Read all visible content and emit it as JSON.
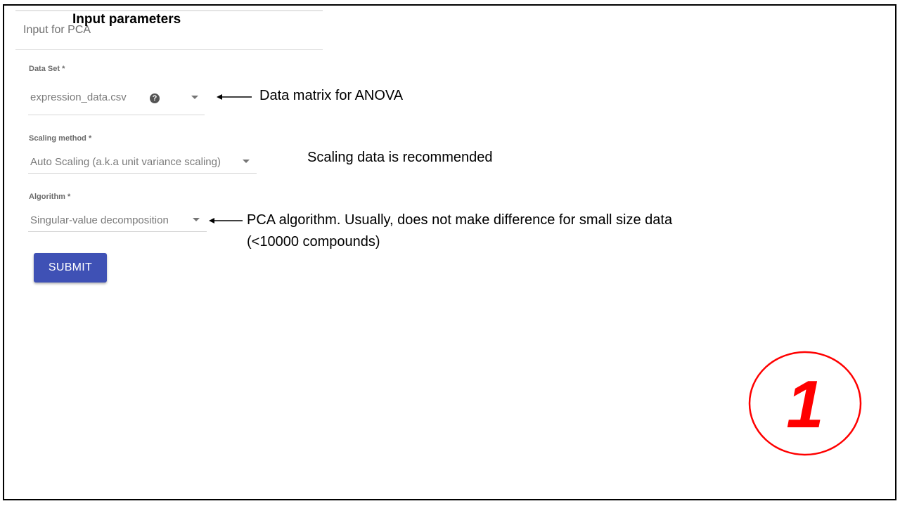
{
  "header": {
    "card_title": "Input for PCA",
    "overlay_title": "Input parameters"
  },
  "fields": {
    "dataset": {
      "label": "Data Set *",
      "value": "expression_data.csv",
      "help_glyph": "?"
    },
    "scaling": {
      "label": "Scaling method *",
      "value": "Auto Scaling (a.k.a unit variance scaling)"
    },
    "algorithm": {
      "label": "Algorithm *",
      "value": "Singular-value decomposition"
    }
  },
  "submit_label": "SUBMIT",
  "annotations": {
    "dataset_note": "Data matrix for ANOVA",
    "scaling_note": "Scaling data is recommended",
    "algorithm_note_line1": "PCA algorithm. Usually, does not make difference for small size data",
    "algorithm_note_line2": "(<10000 compounds)"
  },
  "step_badge": {
    "number": "1",
    "color": "#ff0000"
  },
  "icons": [
    "help-icon",
    "dropdown-caret-icon",
    "arrow-left-icon"
  ]
}
